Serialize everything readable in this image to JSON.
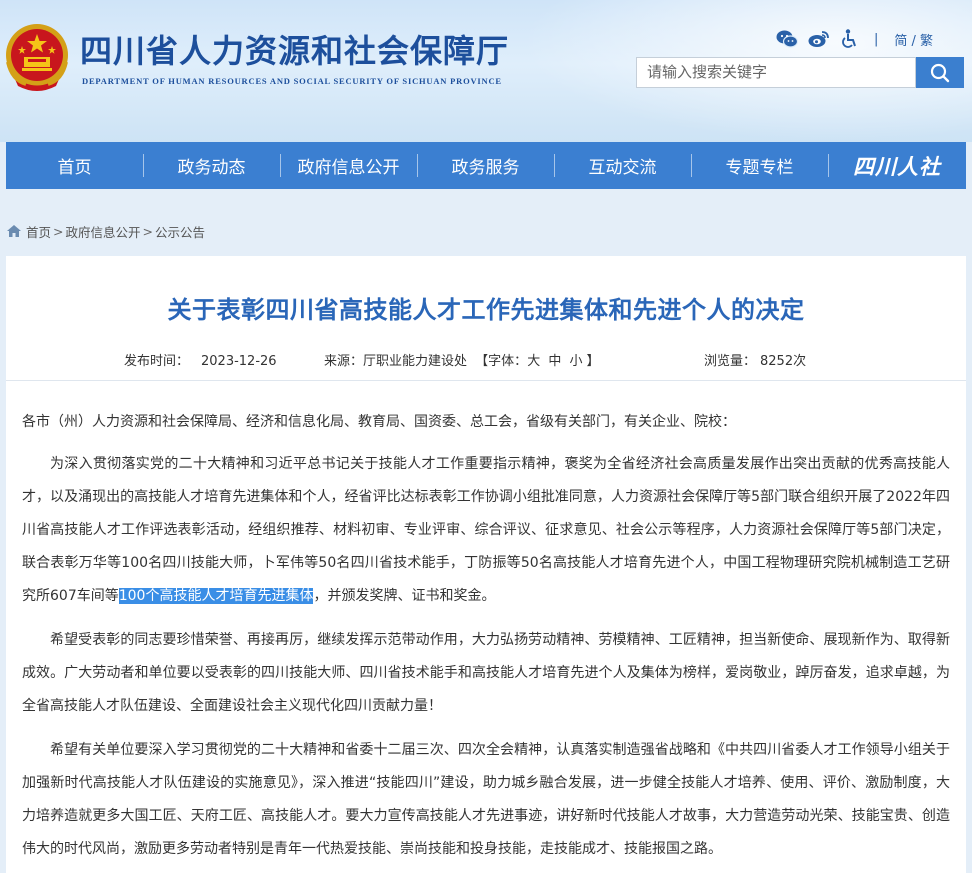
{
  "header": {
    "title": "四川省人力资源和社会保障厅",
    "subtitle": "DEPARTMENT OF HUMAN RESOURCES AND SOCIAL SECURITY OF SICHUAN PROVINCE",
    "lang_toggle": "简 / 繁",
    "tool_icons": [
      "wechat-icon",
      "weibo-icon",
      "accessibility-icon"
    ],
    "search_placeholder": "请输入搜索关键字"
  },
  "nav": {
    "items": [
      "首页",
      "政务动态",
      "政府信息公开",
      "政务服务",
      "互动交流",
      "专题专栏"
    ],
    "logo_text": "四川人社"
  },
  "breadcrumb": {
    "items": [
      "首页",
      "政府信息公开",
      "公示公告"
    ],
    "separator": ">"
  },
  "article": {
    "title": "关于表彰四川省高技能人才工作先进集体和先进个人的决定",
    "publish_label": "发布时间：",
    "publish_date": "2023-12-26",
    "source_label": "来源：",
    "source": "厅职业能力建设处",
    "font_label_open": "【字体：",
    "font_large": "大",
    "font_medium": "中",
    "font_small": "小",
    "font_label_close": "】",
    "views_label": "浏览量：",
    "views": "8252次",
    "salutation": "各市（州）人力资源和社会保障局、经济和信息化局、教育局、国资委、总工会，省级有关部门，有关企业、院校：",
    "p1_before": "为深入贯彻落实党的二十大精神和习近平总书记关于技能人才工作重要指示精神，褒奖为全省经济社会高质量发展作出突出贡献的优秀高技能人才，以及涌现出的高技能人才培育先进集体和个人，经省评比达标表彰工作协调小组批准同意，人力资源社会保障厅等5部门联合组织开展了2022年四川省高技能人才工作评选表彰活动，经组织推荐、材料初审、专业评审、综合评议、征求意见、社会公示等程序，人力资源社会保障厅等5部门决定，联合表彰万华等100名四川技能大师，卜军伟等50名四川省技术能手，丁防振等50名高技能人才培育先进个人，中国工程物理研究院机械制造工艺研究所607车间等",
    "p1_highlight": "100个高技能人才培育先进集体",
    "p1_after": "，并颁发奖牌、证书和奖金。",
    "p2": "希望受表彰的同志要珍惜荣誉、再接再厉，继续发挥示范带动作用，大力弘扬劳动精神、劳模精神、工匠精神，担当新使命、展现新作为、取得新成效。广大劳动者和单位要以受表彰的四川技能大师、四川省技术能手和高技能人才培育先进个人及集体为榜样，爱岗敬业，踔厉奋发，追求卓越，为全省高技能人才队伍建设、全面建设社会主义现代化四川贡献力量！",
    "p3": "希望有关单位要深入学习贯彻党的二十大精神和省委十二届三次、四次全会精神，认真落实制造强省战略和《中共四川省委人才工作领导小组关于加强新时代高技能人才队伍建设的实施意见》，深入推进“技能四川”建设，助力城乡融合发展，进一步健全技能人才培养、使用、评价、激励制度，大力培养造就更多大国工匠、天府工匠、高技能人才。要大力宣传高技能人才先进事迹，讲好新时代技能人才故事，大力营造劳动光荣、技能宝贵、创造伟大的时代风尚，激励更多劳动者特别是青年一代热爱技能、崇尚技能和投身技能，走技能成才、技能报国之路。"
  },
  "colors": {
    "nav_bg": "#3b7fd1",
    "title_blue": "#2a66b8",
    "header_text": "#1d4f9c",
    "highlight": "#3a8ee6"
  }
}
